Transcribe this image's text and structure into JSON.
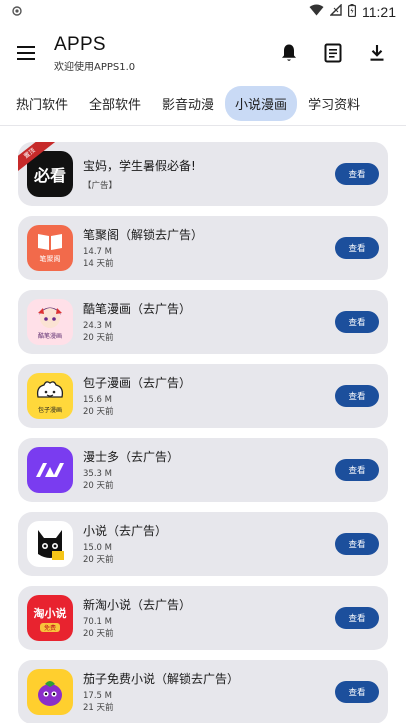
{
  "status_bar": {
    "time": "11:21",
    "icons": [
      "notification-dot-icon",
      "wifi-icon",
      "signal-icon",
      "battery-icon"
    ]
  },
  "app_bar": {
    "title": "APPS",
    "subtitle": "欢迎使用APPS1.0",
    "actions": [
      "bell-icon",
      "document-icon",
      "download-icon"
    ]
  },
  "tabs": [
    {
      "label": "热门软件",
      "active": false
    },
    {
      "label": "全部软件",
      "active": false
    },
    {
      "label": "影音动漫",
      "active": false
    },
    {
      "label": "小说漫画",
      "active": true
    },
    {
      "label": "学习资料",
      "active": false
    }
  ],
  "apps": [
    {
      "name": "宝妈，学生暑假必备!",
      "line1": "",
      "line2": "【广告】",
      "button": "查看",
      "ribbon": "置顶",
      "icon_text": "必看",
      "icon_bg": "#111111"
    },
    {
      "name": "笔聚阁（解锁去广告）",
      "line1": "14.7 M",
      "line2": "14 天前",
      "button": "查看",
      "icon_text": "笔聚阁",
      "icon_bg": "#f26a4b"
    },
    {
      "name": "酷笔漫画（去广告）",
      "line1": "24.3 M",
      "line2": "20 天前",
      "button": "查看",
      "icon_text": "酷笔漫画",
      "icon_bg": "#ffe0e8"
    },
    {
      "name": "包子漫画（去广告）",
      "line1": "15.6 M",
      "line2": "20 天前",
      "button": "查看",
      "icon_text": "包子漫画",
      "icon_bg": "#ffd83b"
    },
    {
      "name": "漫士多（去广告）",
      "line1": "35.3 M",
      "line2": "20 天前",
      "button": "查看",
      "icon_text": "",
      "icon_bg": "#7a3cf0"
    },
    {
      "name": "小说（去广告）",
      "line1": "15.0 M",
      "line2": "20 天前",
      "button": "查看",
      "icon_text": "",
      "icon_bg": "#ffffff"
    },
    {
      "name": "新淘小说（去广告）",
      "line1": "70.1 M",
      "line2": "20 天前",
      "button": "查看",
      "icon_text": "淘小说",
      "icon_bg": "#e8232f"
    },
    {
      "name": "茄子免费小说（解锁去广告）",
      "line1": "17.5 M",
      "line2": "21 天前",
      "button": "查看",
      "icon_text": "",
      "icon_bg": "#ffcf2e"
    }
  ],
  "colors": {
    "accent": "#1c4f9c",
    "active_tab": "#c9daf5",
    "card_bg": "#e7e7ec",
    "ribbon": "#c62a2a"
  }
}
